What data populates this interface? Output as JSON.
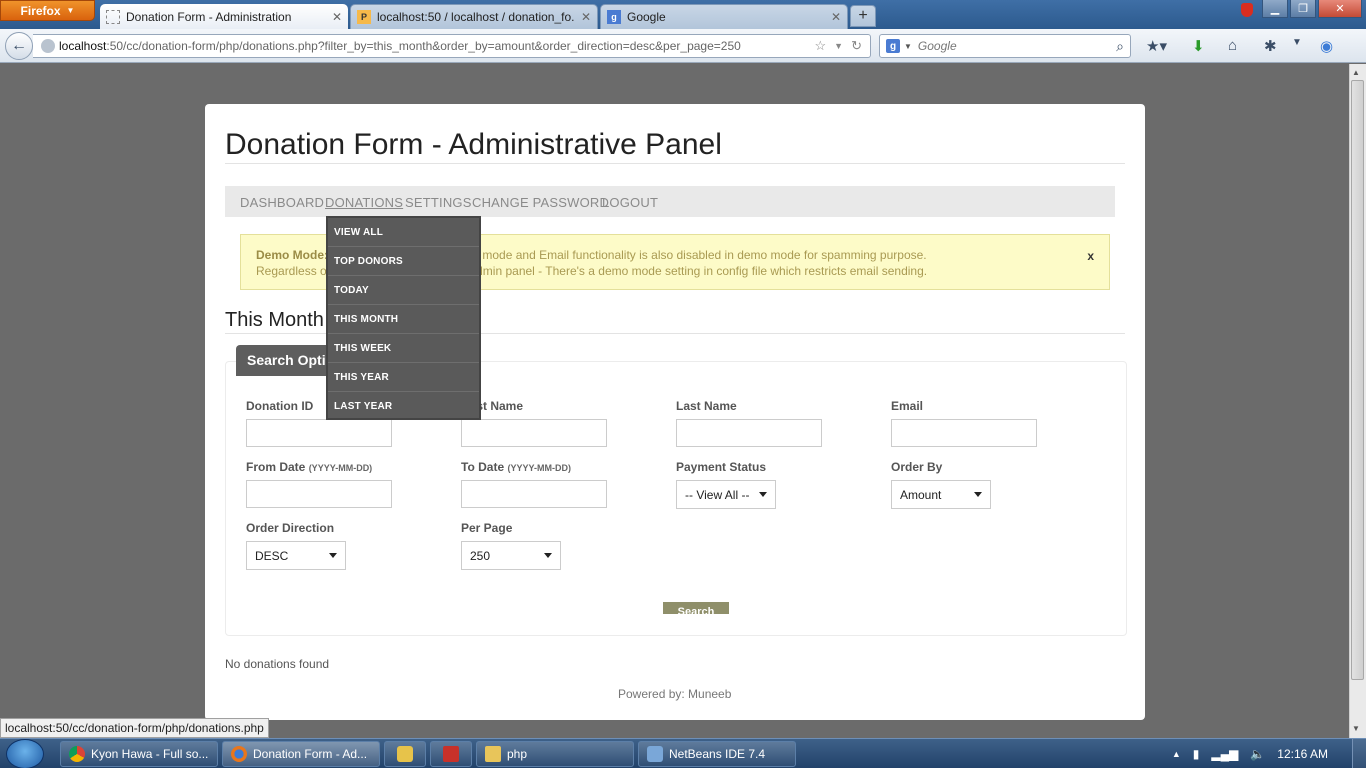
{
  "browser": {
    "app_button": "Firefox",
    "tabs": [
      {
        "title": "Donation Form - Administration"
      },
      {
        "title": "localhost:50 / localhost / donation_fo..."
      },
      {
        "title": "Google"
      }
    ],
    "url_host": "localhost",
    "url_rest": ":50/cc/donation-form/php/donations.php?filter_by=this_month&order_by=amount&order_direction=desc&per_page=250",
    "search_placeholder": "Google",
    "status_url": "localhost:50/cc/donation-form/php/donations.php"
  },
  "page": {
    "title": "Donation Form - Administrative Panel",
    "menu": [
      "DASHBOARD",
      "DONATIONS",
      "SETTINGS",
      "CHANGE PASSWORD",
      "LOGOUT"
    ],
    "dropdown": [
      "VIEW ALL",
      "TOP DONORS",
      "TODAY",
      "THIS MONTH",
      "THIS WEEK",
      "THIS YEAR",
      "LAST YEAR"
    ],
    "alert_label": "Demo Mode:",
    "alert_line1_rest": " won't be applicable in demo mode and Email functionality is also disabled in demo mode for spamming purpose.",
    "alert_line2": "Regardless of the settings you do using admin panel - There's a demo mode setting in config file which restricts email sending.",
    "alert_close": "x",
    "section_title": "This Month",
    "search_tab": "Search Options",
    "fields": {
      "donation_id": "Donation ID",
      "first_name": "First Name",
      "last_name": "Last Name",
      "email": "Email",
      "from_date": "From Date",
      "to_date": "To Date",
      "date_hint": "(YYYY-MM-DD)",
      "payment_status": "Payment Status",
      "payment_status_value": "-- View All --",
      "order_by": "Order By",
      "order_by_value": "Amount",
      "order_direction": "Order Direction",
      "order_direction_value": "DESC",
      "per_page": "Per Page",
      "per_page_value": "250"
    },
    "search_button": "Search",
    "no_results": "No donations found",
    "powered_by": "Powered by: Muneeb"
  },
  "taskbar": {
    "items": [
      "Kyon Hawa - Full so...",
      "Donation Form - Ad...",
      "php",
      "NetBeans IDE 7.4"
    ],
    "clock": "12:16 AM"
  },
  "colors": {
    "menu_bg": "#e9e9e9",
    "dropdown_bg": "#5a5a5a",
    "alert_bg": "#fdfbc8",
    "page_bg": "#6b6b6b"
  }
}
